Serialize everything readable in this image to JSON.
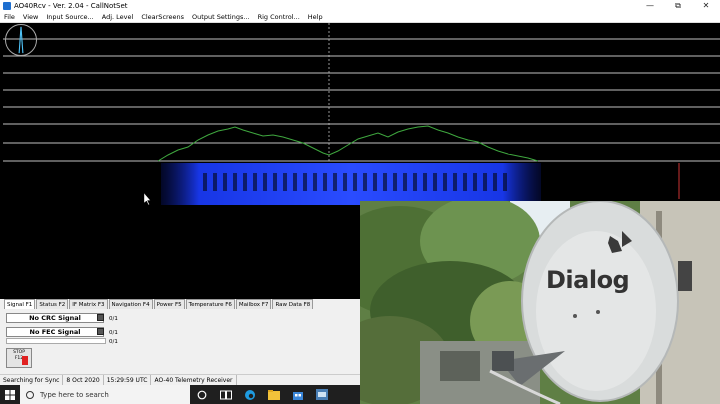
{
  "window": {
    "title": "AO40Rcv - Ver. 2.04 - CallNotSet",
    "buttons": [
      "—",
      "⧉",
      "✕"
    ]
  },
  "menu": [
    "File",
    "View",
    "Input Source...",
    "Adj. Level",
    "ClearScreens",
    "Output Settings...",
    "Rig Control...",
    "Help"
  ],
  "tabs": [
    "Signal F1",
    "Status F2",
    "IF Matrix F3",
    "Navigation F4",
    "Power F5",
    "Temperature F6",
    "Mailbox F7",
    "Raw Data F8"
  ],
  "signals": {
    "crc_label": "No CRC Signal",
    "crc_count": "0/1",
    "fec_label": "No FEC Signal",
    "fec_count": "0/1"
  },
  "stop_button": {
    "line1": "STOP",
    "line2": "F12"
  },
  "statusbar": [
    "Searching for Sync",
    "8 Oct 2020",
    "15:29:59 UTC",
    "AO-40 Telemetry Receiver"
  ],
  "taskbar": {
    "search_placeholder": "Type here to search",
    "icons": [
      "search-ring-icon",
      "task-view-icon",
      "edge-icon",
      "store-icon",
      "app-icon"
    ]
  },
  "photo": {
    "logo_text": "Dialog"
  },
  "colors": {
    "spectrum_line": "#3fa83f",
    "waterfall": "#1a3cff",
    "grid": "#ffffff"
  }
}
